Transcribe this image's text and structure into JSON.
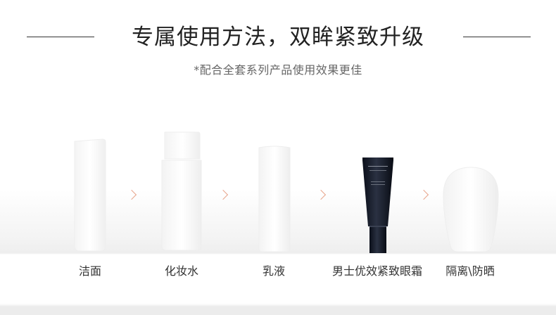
{
  "header": {
    "title": "专属使用方法，双眸紧致升级",
    "subtitle": "*配合全套系列产品使用效果更佳"
  },
  "steps": [
    {
      "label": "洁面",
      "icon": "cleanser-bottle-icon"
    },
    {
      "label": "化妆水",
      "icon": "toner-bottle-icon"
    },
    {
      "label": "乳液",
      "icon": "emulsion-bottle-icon"
    },
    {
      "label": "男士优效紧致眼霜",
      "icon": "eye-cream-tube-icon"
    },
    {
      "label": "隔离\\防晒",
      "icon": "sunscreen-bottle-icon"
    }
  ],
  "colors": {
    "arrow": "#e8a68c",
    "tube": "#111827",
    "text": "#333333"
  }
}
